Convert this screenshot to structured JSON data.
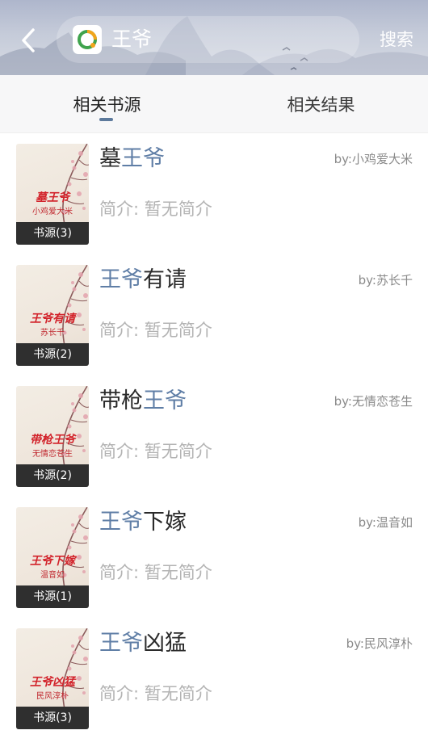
{
  "header": {
    "search_text": "王爷",
    "search_button": "搜索"
  },
  "tabs": [
    {
      "label": "相关书源",
      "active": true
    },
    {
      "label": "相关结果",
      "active": false
    }
  ],
  "colors": {
    "accent": "#5f7ea6",
    "cover_title": "#d2222a",
    "badge_bg": "#2f2f2f"
  },
  "books": [
    {
      "title_parts": [
        {
          "text": "墓",
          "hl": false
        },
        {
          "text": "王爷",
          "hl": true
        }
      ],
      "author": "by:小鸡爱大米",
      "intro": "简介: 暂无简介",
      "cover_title": "墓王爷",
      "cover_author": "小鸡爱大米",
      "badge": "书源(3)"
    },
    {
      "title_parts": [
        {
          "text": "王爷",
          "hl": true
        },
        {
          "text": "有请",
          "hl": false
        }
      ],
      "author": "by:苏长千",
      "intro": "简介: 暂无简介",
      "cover_title": "王爷有请",
      "cover_author": "苏长千",
      "badge": "书源(2)"
    },
    {
      "title_parts": [
        {
          "text": "带枪",
          "hl": false
        },
        {
          "text": "王爷",
          "hl": true
        }
      ],
      "author": "by:无情恋苍生",
      "intro": "简介: 暂无简介",
      "cover_title": "带枪王爷",
      "cover_author": "无情恋苍生",
      "badge": "书源(2)"
    },
    {
      "title_parts": [
        {
          "text": "王爷",
          "hl": true
        },
        {
          "text": "下嫁",
          "hl": false
        }
      ],
      "author": "by:温音如",
      "intro": "简介: 暂无简介",
      "cover_title": "王爷下嫁",
      "cover_author": "温音如",
      "badge": "书源(1)"
    },
    {
      "title_parts": [
        {
          "text": "王爷",
          "hl": true
        },
        {
          "text": "凶猛",
          "hl": false
        }
      ],
      "author": "by:民风淳朴",
      "intro": "简介: 暂无简介",
      "cover_title": "王爷凶猛",
      "cover_author": "民风淳朴",
      "badge": "书源(3)"
    }
  ]
}
